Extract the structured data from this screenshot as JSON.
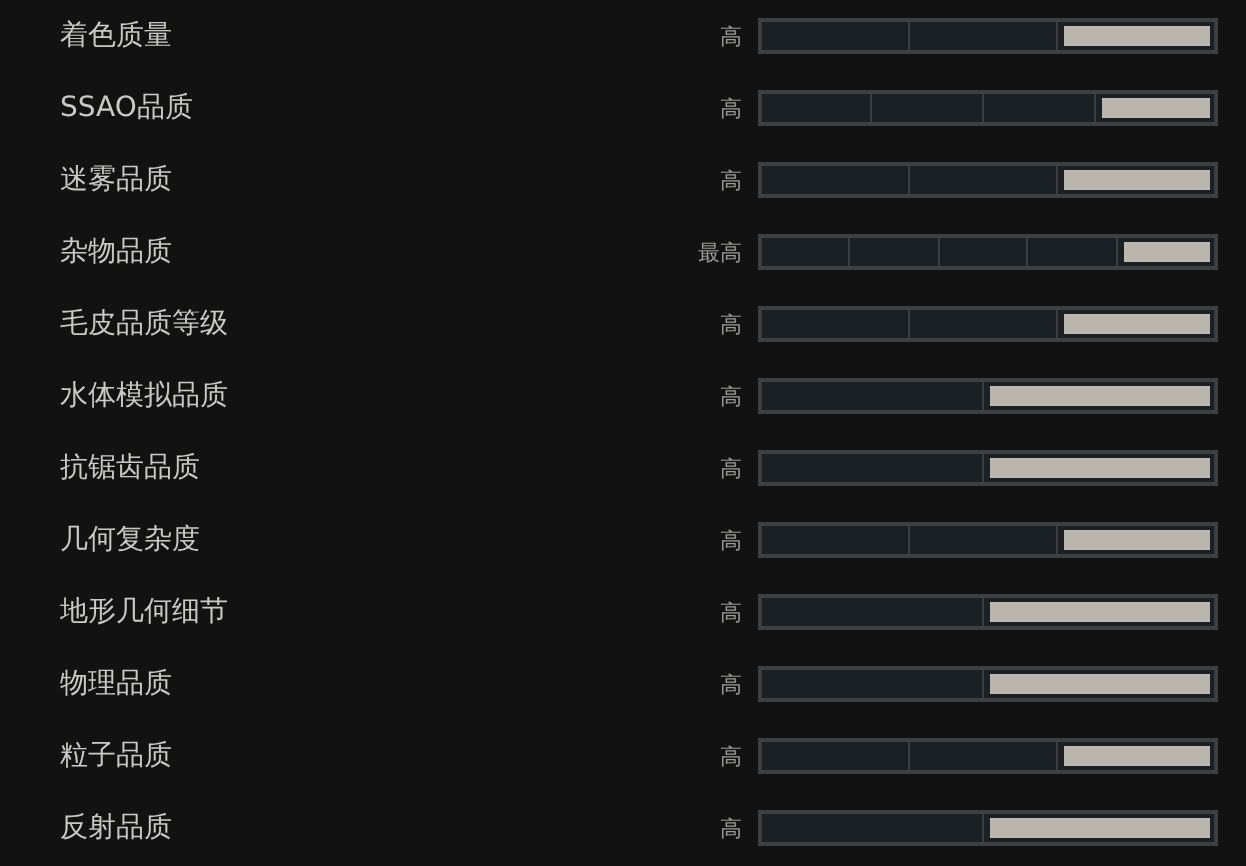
{
  "settings": [
    {
      "label": "着色质量",
      "value": "高",
      "segments": [
        {
          "selected": false
        },
        {
          "selected": false
        },
        {
          "selected": true
        }
      ]
    },
    {
      "label": "SSAO品质",
      "value": "高",
      "segments": [
        {
          "selected": false
        },
        {
          "selected": false
        },
        {
          "selected": false
        },
        {
          "selected": true
        }
      ]
    },
    {
      "label": "迷雾品质",
      "value": "高",
      "segments": [
        {
          "selected": false
        },
        {
          "selected": false
        },
        {
          "selected": true
        }
      ]
    },
    {
      "label": "杂物品质",
      "value": "最高",
      "segments": [
        {
          "selected": false
        },
        {
          "selected": false
        },
        {
          "selected": false
        },
        {
          "selected": false
        },
        {
          "selected": true
        }
      ]
    },
    {
      "label": "毛皮品质等级",
      "value": "高",
      "segments": [
        {
          "selected": false
        },
        {
          "selected": false
        },
        {
          "selected": true
        }
      ]
    },
    {
      "label": "水体模拟品质",
      "value": "高",
      "segments": [
        {
          "selected": false
        },
        {
          "selected": true
        }
      ]
    },
    {
      "label": "抗锯齿品质",
      "value": "高",
      "segments": [
        {
          "selected": false
        },
        {
          "selected": true
        }
      ]
    },
    {
      "label": "几何复杂度",
      "value": "高",
      "segments": [
        {
          "selected": false
        },
        {
          "selected": false
        },
        {
          "selected": true
        }
      ]
    },
    {
      "label": "地形几何细节",
      "value": "高",
      "segments": [
        {
          "selected": false
        },
        {
          "selected": true
        }
      ]
    },
    {
      "label": "物理品质",
      "value": "高",
      "segments": [
        {
          "selected": false
        },
        {
          "selected": true
        }
      ]
    },
    {
      "label": "粒子品质",
      "value": "高",
      "segments": [
        {
          "selected": false
        },
        {
          "selected": false
        },
        {
          "selected": true
        }
      ]
    },
    {
      "label": "反射品质",
      "value": "高",
      "segments": [
        {
          "selected": false
        },
        {
          "selected": true
        }
      ]
    }
  ]
}
